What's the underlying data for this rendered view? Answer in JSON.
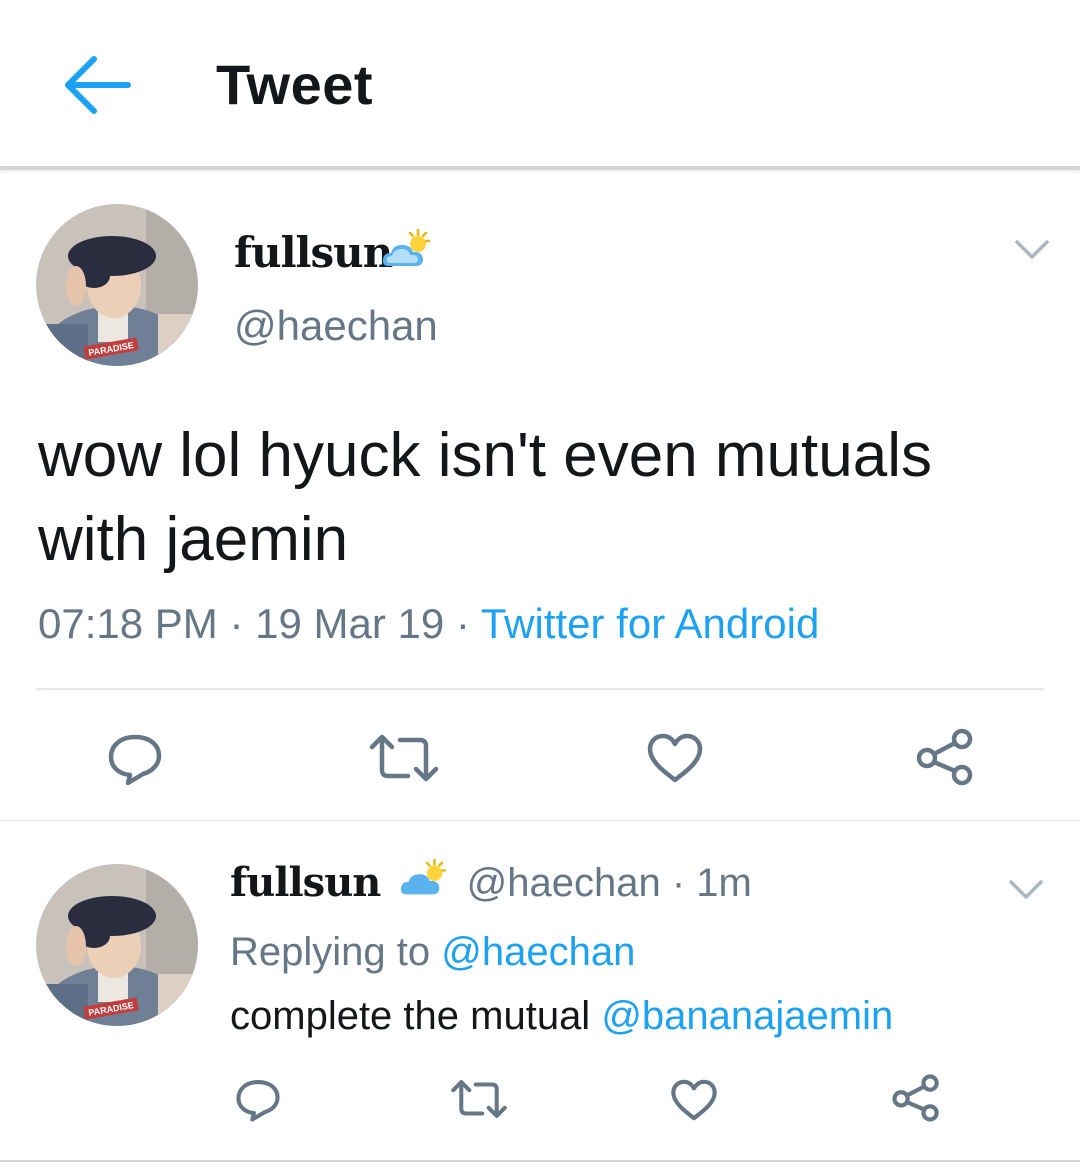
{
  "header": {
    "title": "Tweet",
    "back_icon": "arrow-left-icon"
  },
  "main_tweet": {
    "display_name": "fullsun",
    "name_emoji": "sun-behind-cloud-icon",
    "handle": "@haechan",
    "text": "wow lol hyuck isn't even mutuals with jaemin",
    "time": "07:18 PM",
    "separator": "·",
    "date": "19 Mar 19",
    "source": "Twitter for Android",
    "avatar_badge": "PARADISE"
  },
  "reply": {
    "display_name": "fullsun",
    "handle": "@haechan",
    "separator": "·",
    "age": "1m",
    "replying_prefix": "Replying to",
    "replying_to": "@haechan",
    "text": "complete the mutual",
    "mention": "@bananajaemin",
    "avatar_badge": "PARADISE"
  },
  "colors": {
    "accent": "#1da1f2",
    "secondary_text": "#657786",
    "primary_text": "#14171a",
    "divider": "#e1e8ed"
  }
}
